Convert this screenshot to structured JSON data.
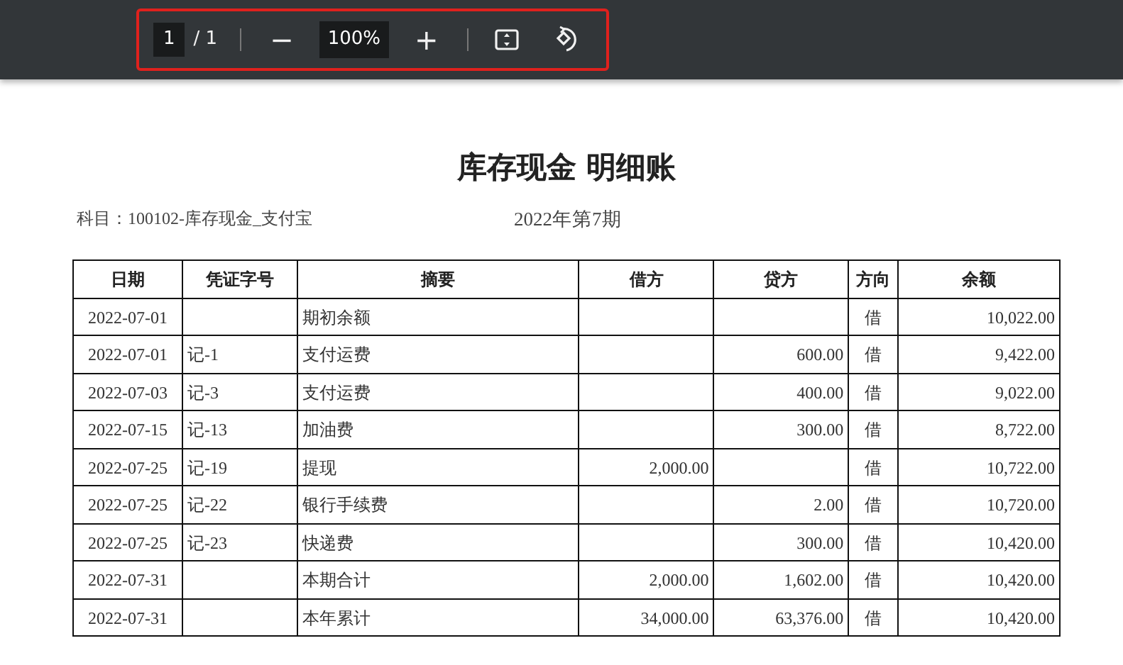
{
  "toolbar": {
    "page_number": "1",
    "page_total": "/ 1",
    "zoom_out": "−",
    "zoom": "100%",
    "zoom_in": "+"
  },
  "document": {
    "title": "库存现金 明细账",
    "subject": "科目：100102-库存现金_支付宝",
    "period": "2022年第7期",
    "table": {
      "columns": [
        "日期",
        "凭证字号",
        "摘要",
        "借方",
        "贷方",
        "方向",
        "余额"
      ],
      "rows": [
        [
          "2022-07-01",
          "",
          "期初余额",
          "",
          "",
          "借",
          "10,022.00"
        ],
        [
          "2022-07-01",
          "记-1",
          "支付运费",
          "",
          "600.00",
          "借",
          "9,422.00"
        ],
        [
          "2022-07-03",
          "记-3",
          "支付运费",
          "",
          "400.00",
          "借",
          "9,022.00"
        ],
        [
          "2022-07-15",
          "记-13",
          "加油费",
          "",
          "300.00",
          "借",
          "8,722.00"
        ],
        [
          "2022-07-25",
          "记-19",
          "提现",
          "2,000.00",
          "",
          "借",
          "10,722.00"
        ],
        [
          "2022-07-25",
          "记-22",
          "银行手续费",
          "",
          "2.00",
          "借",
          "10,720.00"
        ],
        [
          "2022-07-25",
          "记-23",
          "快递费",
          "",
          "300.00",
          "借",
          "10,420.00"
        ],
        [
          "2022-07-31",
          "",
          "本期合计",
          "2,000.00",
          "1,602.00",
          "借",
          "10,420.00"
        ],
        [
          "2022-07-31",
          "",
          "本年累计",
          "34,000.00",
          "63,376.00",
          "借",
          "10,420.00"
        ]
      ]
    }
  }
}
